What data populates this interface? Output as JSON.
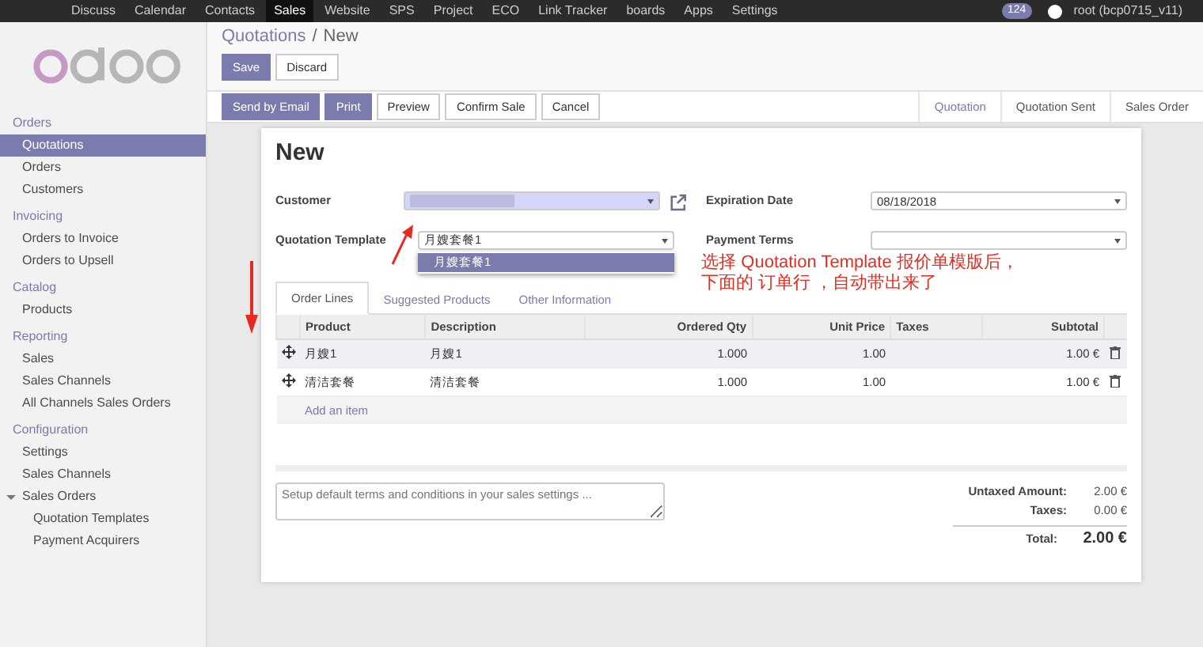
{
  "top_menu": {
    "items": [
      {
        "label": "Discuss",
        "selected": false
      },
      {
        "label": "Calendar",
        "selected": false
      },
      {
        "label": "Contacts",
        "selected": false
      },
      {
        "label": "Sales",
        "selected": true
      },
      {
        "label": "Website",
        "selected": false
      },
      {
        "label": "SPS",
        "selected": false
      },
      {
        "label": "Project",
        "selected": false
      },
      {
        "label": "ECO",
        "selected": false
      },
      {
        "label": "Link Tracker",
        "selected": false
      },
      {
        "label": "boards",
        "selected": false
      },
      {
        "label": "Apps",
        "selected": false
      },
      {
        "label": "Settings",
        "selected": false
      }
    ],
    "message_count": "124",
    "user": "root (bcp0715_v11)"
  },
  "sidebar": {
    "sections": [
      {
        "title": "Orders",
        "items": [
          {
            "label": "Quotations",
            "selected": true
          },
          {
            "label": "Orders",
            "selected": false
          },
          {
            "label": "Customers",
            "selected": false
          }
        ]
      },
      {
        "title": "Invoicing",
        "items": [
          {
            "label": "Orders to Invoice",
            "selected": false
          },
          {
            "label": "Orders to Upsell",
            "selected": false
          }
        ]
      },
      {
        "title": "Catalog",
        "items": [
          {
            "label": "Products",
            "selected": false
          }
        ]
      },
      {
        "title": "Reporting",
        "items": [
          {
            "label": "Sales",
            "selected": false
          },
          {
            "label": "Sales Channels",
            "selected": false
          },
          {
            "label": "All Channels Sales Orders",
            "selected": false
          }
        ]
      },
      {
        "title": "Configuration",
        "items": [
          {
            "label": "Settings",
            "selected": false
          },
          {
            "label": "Sales Channels",
            "selected": false
          },
          {
            "label": "Sales Orders",
            "selected": false,
            "expanded": true,
            "children": [
              {
                "label": "Quotation Templates",
                "selected": false
              },
              {
                "label": "Payment Acquirers",
                "selected": false
              }
            ]
          }
        ]
      }
    ]
  },
  "breadcrumb": {
    "parent": "Quotations",
    "separator": "/",
    "current": "New"
  },
  "form_buttons": [
    {
      "label": "Save",
      "kind": "primary"
    },
    {
      "label": "Discard",
      "kind": "secondary"
    }
  ],
  "action_buttons": [
    {
      "label": "Send by Email",
      "kind": "primary"
    },
    {
      "label": "Print",
      "kind": "primary"
    },
    {
      "label": "Preview",
      "kind": "secondary"
    },
    {
      "label": "Confirm Sale",
      "kind": "secondary"
    },
    {
      "label": "Cancel",
      "kind": "secondary"
    }
  ],
  "status_steps": [
    {
      "label": "Quotation",
      "selected": true
    },
    {
      "label": "Quotation Sent",
      "selected": false
    },
    {
      "label": "Sales Order",
      "selected": false
    }
  ],
  "sheet": {
    "title": "New",
    "left_fields": [
      {
        "label": "Customer",
        "focused": true
      },
      {
        "label": "Quotation Template",
        "value": "月嫂套餐1",
        "focused": false
      }
    ],
    "right_fields": [
      {
        "label": "Expiration Date",
        "value": "08/18/2018"
      },
      {
        "label": "Payment Terms"
      }
    ],
    "dropdown_options": [
      {
        "label": "月嫂套餐1",
        "selected": true
      }
    ],
    "tabs": [
      {
        "label": "Order Lines",
        "selected": true
      },
      {
        "label": "Suggested Products",
        "selected": false
      },
      {
        "label": "Other Information",
        "selected": false
      }
    ],
    "columns": [
      "Product",
      "Description",
      "Ordered Qty",
      "Unit Price",
      "Taxes",
      "Subtotal"
    ],
    "rows": [
      {
        "product": "月嫂1",
        "description": "月嫂1",
        "qty": "1.000",
        "price": "1.00",
        "taxes": "",
        "subtotal": "1.00 €"
      },
      {
        "product": "清洁套餐",
        "description": "清洁套餐",
        "qty": "1.000",
        "price": "1.00",
        "taxes": "",
        "subtotal": "1.00 €"
      }
    ],
    "add_item": "Add an item",
    "terms": {
      "placeholder": "Setup default terms and conditions in your sales settings ..."
    },
    "totals": [
      {
        "label": "Untaxed Amount:",
        "value": "2.00 €",
        "kind": "normal"
      },
      {
        "label": "Taxes:",
        "value": "0.00 €",
        "kind": "normal"
      },
      {
        "label": "Total:",
        "value": "2.00 €",
        "kind": "grand"
      }
    ]
  },
  "annotation": {
    "lines": [
      "选择 Quotation Template 报价单模版后，",
      "下面的 订单行 ，自动带出来了"
    ]
  }
}
